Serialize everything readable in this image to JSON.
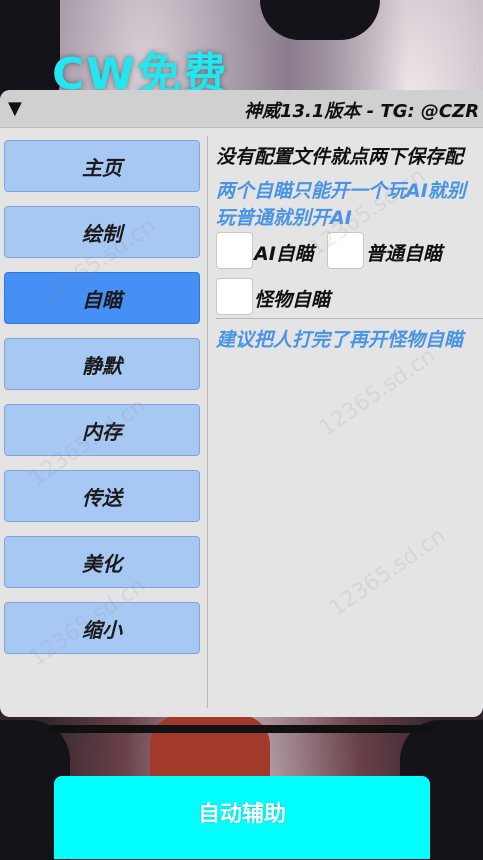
{
  "logo": "CW免费",
  "panel": {
    "title": "神威13.1版本 - TG: @CZR",
    "collapse_glyph": "▼"
  },
  "nav": [
    {
      "label": "主页"
    },
    {
      "label": "绘制"
    },
    {
      "label": "自瞄",
      "active": true
    },
    {
      "label": "静默"
    },
    {
      "label": "内存"
    },
    {
      "label": "传送"
    },
    {
      "label": "美化"
    },
    {
      "label": "缩小"
    }
  ],
  "content": {
    "notice": "没有配置文件就点两下保存配",
    "tip_line1": "两个自瞄只能开一个玩AI就别",
    "tip_line2": "玩普通就别开AI",
    "options": [
      {
        "label": "AI自瞄",
        "checked": false
      },
      {
        "label": "普通自瞄",
        "checked": false
      },
      {
        "label": "怪物自瞄",
        "checked": false
      }
    ],
    "advice": "建议把人打完了再开怪物自瞄"
  },
  "bottom_button": "自动辅助",
  "watermark": "12365.sd.cn",
  "colors": {
    "logo": "#22e6f0",
    "nav_button": "#a8c8f4",
    "nav_active": "#4690f5",
    "hint_text": "#4a94e8",
    "bottom_button": "#00ffff"
  }
}
